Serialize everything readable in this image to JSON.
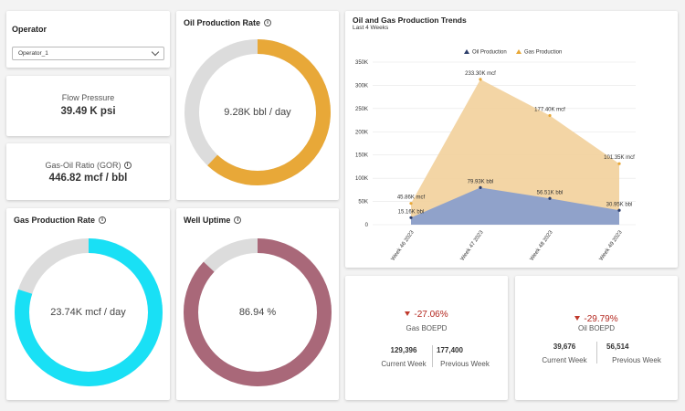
{
  "operator": {
    "label": "Operator",
    "selected": "Operator_1"
  },
  "flow_pressure": {
    "label": "Flow Pressure",
    "value": "39.49 K psi"
  },
  "gor": {
    "label": "Gas-Oil Ratio (GOR)",
    "value": "446.82 mcf / bbl"
  },
  "oil_rate": {
    "title": "Oil Production Rate",
    "center": "9.28K bbl / day",
    "fill_fraction": 0.62,
    "color": "#e8a838",
    "track": "#dcdcdc"
  },
  "gas_rate": {
    "title": "Gas Production Rate",
    "center": "23.74K mcf / day",
    "fill_fraction": 0.8,
    "color": "#19e0f5",
    "track": "#dcdcdc"
  },
  "uptime": {
    "title": "Well Uptime",
    "center": "86.94 %",
    "fill_fraction": 0.8694,
    "color": "#a96879",
    "track": "#dcdcdc"
  },
  "trends": {
    "title": "Oil and Gas Production Trends",
    "subtitle": "Last 4 Weeks"
  },
  "chart_data": {
    "type": "area",
    "categories": [
      "Week 46 2023",
      "Week 47 2023",
      "Week 48 2023",
      "Week 49 2023"
    ],
    "series": [
      {
        "name": "Oil Production",
        "values": [
          15160,
          79930,
          56510,
          30950
        ],
        "labels": [
          "15.16K bbl",
          "79.93K bbl",
          "56.51K bbl",
          "30.95K bbl"
        ],
        "color": "#8a9fcb",
        "point_color": "#2d3e6b"
      },
      {
        "name": "Gas Production",
        "values": [
          45860,
          313000,
          235000,
          131350
        ],
        "labels": [
          "45.86K mcf",
          "233.30K mcf",
          "177.40K mcf",
          "101.35K mcf"
        ],
        "color": "#f2d3a0",
        "point_color": "#e8a838"
      }
    ],
    "y_ticks": [
      "0",
      "50K",
      "100K",
      "150K",
      "200K",
      "250K",
      "300K",
      "350K"
    ],
    "ylim": [
      0,
      350000
    ],
    "legend_position": "top",
    "grid": true
  },
  "gas_boepd": {
    "delta": "-27.06%",
    "label": "Gas BOEPD",
    "current_value": "129,396",
    "current_label": "Current Week",
    "previous_value": "177,400",
    "previous_label": "Previous Week"
  },
  "oil_boepd": {
    "delta": "-29.79%",
    "label": "Oil BOEPD",
    "current_value": "39,676",
    "current_label": "Current Week",
    "previous_value": "56,514",
    "previous_label": "Previous Week"
  }
}
